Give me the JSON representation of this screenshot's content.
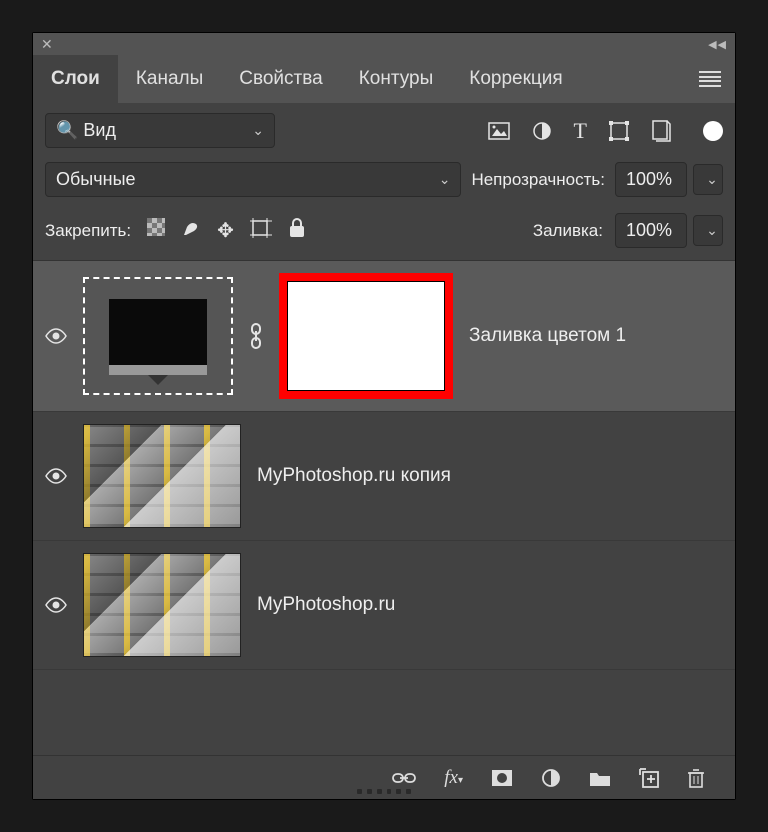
{
  "tabs": [
    "Слои",
    "Каналы",
    "Свойства",
    "Контуры",
    "Коррекция"
  ],
  "active_tab": 0,
  "kind_label": "Вид",
  "blend_mode": "Обычные",
  "opacity_label": "Непрозрачность:",
  "opacity_value": "100%",
  "lock_label": "Закрепить:",
  "fill_label": "Заливка:",
  "fill_value": "100%",
  "layers": [
    {
      "name": "Заливка цветом 1",
      "visible": true,
      "selected": true,
      "type": "fill",
      "mask_highlight": true
    },
    {
      "name": "MyPhotoshop.ru копия",
      "visible": true,
      "selected": false,
      "type": "image"
    },
    {
      "name": "MyPhotoshop.ru",
      "visible": true,
      "selected": false,
      "type": "image"
    }
  ],
  "filter_icons": [
    "image-icon",
    "adjust-icon",
    "type-icon",
    "shape-icon",
    "smart-icon"
  ],
  "footer_icons": [
    "link-icon",
    "fx-icon",
    "mask-icon",
    "adjustment-icon",
    "group-icon",
    "newlayer-icon",
    "trash-icon"
  ]
}
